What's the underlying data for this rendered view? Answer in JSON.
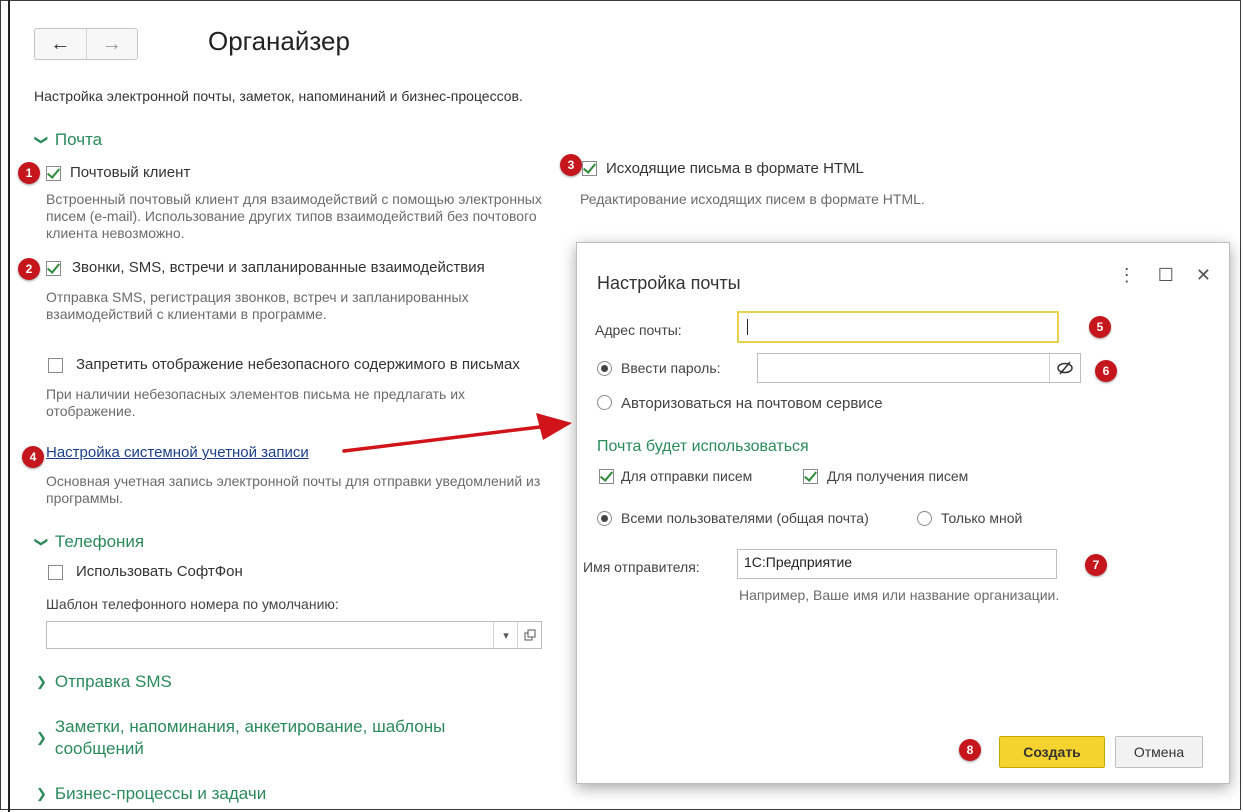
{
  "nav": {
    "back_glyph": "←",
    "forward_glyph": "→"
  },
  "page": {
    "title": "Органайзер",
    "description": "Настройка электронной почты, заметок, напоминаний и бизнес-процессов."
  },
  "mail_section": {
    "header": "Почта",
    "mail_client": {
      "label": "Почтовый клиент",
      "checked": true,
      "description": "Встроенный почтовый клиент для взаимодействий с помощью электронных писем (e-mail). Использование других типов взаимодействий без почтового клиента невозможно."
    },
    "html_outgoing": {
      "label": "Исходящие письма в формате HTML",
      "checked": true,
      "description": "Редактирование исходящих писем в формате HTML."
    },
    "calls_sms": {
      "label": "Звонки, SMS, встречи и запланированные взаимодействия",
      "checked": true,
      "description": "Отправка SMS, регистрация звонков, встреч и запланированных взаимодействий с клиентами в программе."
    },
    "block_unsafe": {
      "label": "Запретить отображение небезопасного содержимого в письмах",
      "checked": false,
      "description": "При наличии небезопасных элементов письма не предлагать их отображение."
    },
    "system_account_link": "Настройка системной учетной записи",
    "system_account_description": "Основная учетная запись электронной почты для отправки уведомлений из программы."
  },
  "telephony_section": {
    "header": "Телефония",
    "use_softphone": {
      "label": "Использовать СофтФон",
      "checked": false
    },
    "template_label": "Шаблон телефонного номера по умолчанию:",
    "template_value": ""
  },
  "collapsed_sections": {
    "sms": "Отправка SMS",
    "notes_line1": "Заметки, напоминания, анкетирование, шаблоны",
    "notes_line2": "сообщений",
    "business": "Бизнес-процессы и задачи"
  },
  "dialog": {
    "title": "Настройка почты",
    "email_label": "Адрес почты:",
    "email_value": "",
    "password_radio_label": "Ввести пароль:",
    "password_value": "",
    "oauth_radio_label": "Авторизоваться на почтовом сервисе",
    "usage_header": "Почта будет использоваться",
    "send_label": "Для отправки писем",
    "receive_label": "Для получения писем",
    "all_users_label": "Всеми пользователями (общая почта)",
    "only_me_label": "Только мной",
    "sender_label": "Имя отправителя:",
    "sender_value": "1С:Предприятие",
    "sender_hint": "Например, Ваше имя или название организации.",
    "create_button": "Создать",
    "cancel_button": "Отмена"
  },
  "badges": [
    "1",
    "2",
    "3",
    "4",
    "5",
    "6",
    "7",
    "8"
  ],
  "colors": {
    "accent_green": "#2b8a5a",
    "badge_red": "#c4161c",
    "primary_yellow": "#f5d32e",
    "link_blue": "#1c3f8a",
    "arrow_red": "#d0141a"
  },
  "icons": [
    "back-arrow-icon",
    "forward-arrow-icon",
    "chevron-down-icon",
    "chevron-right-icon",
    "more-vert-icon",
    "maximize-icon",
    "close-icon",
    "eye-off-icon",
    "dropdown-arrow-icon",
    "open-window-icon",
    "red-arrow-icon"
  ]
}
